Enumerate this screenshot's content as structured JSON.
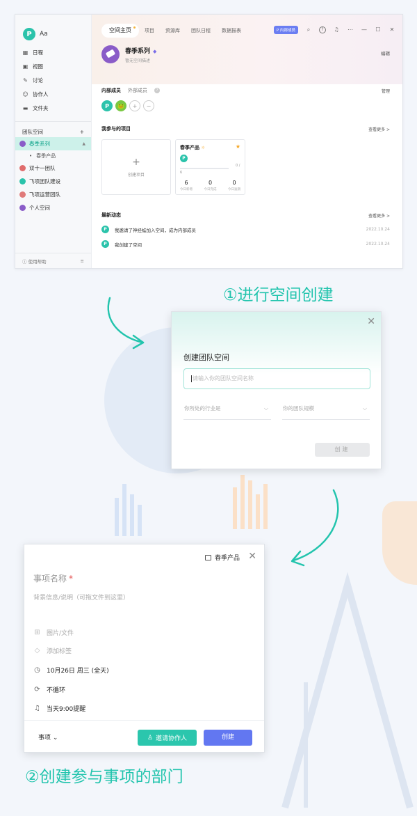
{
  "colors": {
    "accent": "#2bc3ab",
    "primary_blue": "#6277f1",
    "caption": "#22c4ad",
    "required": "#e45454"
  },
  "sidebar": {
    "workspace_name": "Aa",
    "nav": [
      {
        "label": "日程",
        "icon": "calendar-icon"
      },
      {
        "label": "视图",
        "icon": "view-icon"
      },
      {
        "label": "讨论",
        "icon": "discussion-icon"
      },
      {
        "label": "协作人",
        "icon": "collaborator-icon"
      },
      {
        "label": "文件夹",
        "icon": "folder-icon"
      }
    ],
    "section_title": "团队空间",
    "section_add": "+",
    "spaces": [
      {
        "label": "春季系列",
        "color": "#8a5cc8",
        "active": true
      },
      {
        "label": "双十一团队",
        "color": "#e06c6c"
      },
      {
        "label": "飞项团队建设",
        "color": "#2bc3ab"
      },
      {
        "label": "飞项运营团队",
        "color": "#e07a7a"
      },
      {
        "label": "个人空间",
        "color": "#8a5cc8"
      }
    ],
    "sub_item": "春季产品",
    "help": "使用帮助"
  },
  "header": {
    "tabs": [
      "空间主页",
      "项目",
      "资源库",
      "团队日程",
      "数据报表"
    ],
    "badge": "内部成员"
  },
  "space": {
    "title": "春季系列",
    "description": "暂无空间描述",
    "edit": "编辑"
  },
  "members": {
    "tab_internal": "内部成员",
    "tab_external": "外部成员",
    "manage": "管理"
  },
  "projects": {
    "title": "我参与的项目",
    "see_more": "查看更多 >",
    "new_label": "创建项目",
    "card": {
      "title": "春季产品",
      "progress_text": "0 / 6",
      "progress_fraction": 0,
      "stats": [
        {
          "value": "6",
          "label": "今日新增"
        },
        {
          "value": "0",
          "label": "今日完成"
        },
        {
          "value": "0",
          "label": "今日逾期"
        }
      ]
    }
  },
  "activity": {
    "title": "最新动态",
    "see_more": "查看更多 >",
    "items": [
      {
        "text": "我邀请了神经蛙加入空间，成为内部成员",
        "date": "2022.10.24"
      },
      {
        "text": "我创建了空间",
        "date": "2022.10.24"
      }
    ]
  },
  "caption1": "①进行空间创建",
  "caption2": "②创建参与事项的部门",
  "dialog_space": {
    "title": "创建团队空间",
    "input_placeholder": "请输入你的团队空间名称",
    "industry_placeholder": "你所处的行业是",
    "size_placeholder": "你的团队规模",
    "create_button": "创建"
  },
  "dialog_task": {
    "project": "春季产品",
    "name_placeholder": "事项名称",
    "required_mark": "*",
    "description_placeholder": "背景信息/说明（可拖文件到这里）",
    "attachment": "图片/文件",
    "tag": "添加标签",
    "date": "10月26日 周三 (全天)",
    "repeat": "不循环",
    "reminder": "当天9:00提醒",
    "type": "事项",
    "invite_button": "邀请协作人",
    "create_button": "创建"
  }
}
